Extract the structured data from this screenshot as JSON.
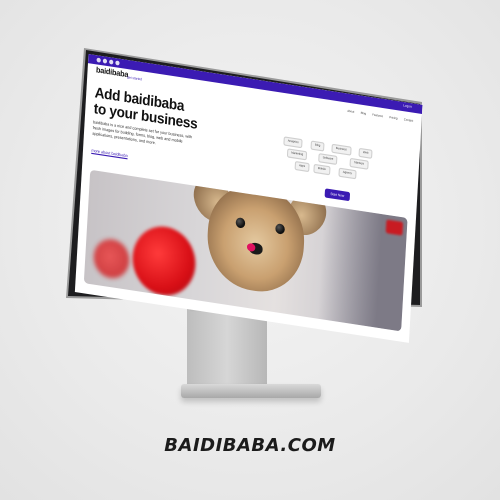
{
  "screen": {
    "topbar": {
      "login_label": "Log in"
    },
    "logo": "baidibaba",
    "logo_sub": "get started",
    "menu": [
      "About",
      "Blog",
      "Features",
      "Pricing",
      "Contact"
    ],
    "hero_title_line1": "Add baidibaba",
    "hero_title_line2": "to your business",
    "hero_text": "baidibaba is a nice and complete set for your business, with fresh images for building, forms, blog, web and mobile applications, presentations, and more.",
    "hero_link": "more about baidibaba",
    "tags": [
      "Analytics",
      "Blog",
      "Business",
      "Web",
      "Marketing",
      "Software",
      "Startups",
      "Apps",
      "Mobile",
      "Agency"
    ],
    "cta_label": "Start Now"
  },
  "brand_caption": "BAIDIBABA.COM",
  "colors": {
    "accent": "#3b1bb3",
    "background": "#ececec",
    "bezel": "#1d1d1f"
  }
}
